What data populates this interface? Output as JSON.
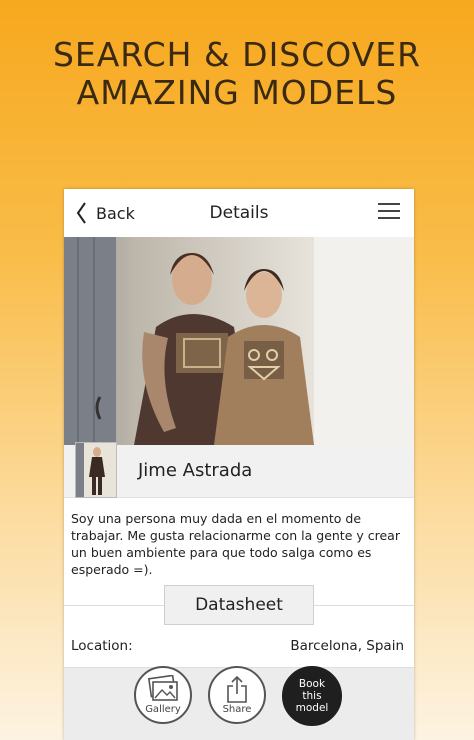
{
  "promo": {
    "headline_line1": "SEARCH & DISCOVER",
    "headline_line2": "AMAZING MODELS"
  },
  "navbar": {
    "back_label": "Back",
    "title": "Details",
    "menu_icon": "hamburger-menu-icon"
  },
  "model": {
    "name": "Jime Astrada",
    "bio": "Soy una persona muy dada en el momento de trabajar. Me gusta relacionarme con la gente y crear un buen ambiente para que todo salga como es esperado =)."
  },
  "datasheet": {
    "button_label": "Datasheet",
    "location_label": "Location:",
    "location_value": "Barcelona, Spain"
  },
  "actions": {
    "gallery_label": "Gallery",
    "share_label": "Share",
    "book_label": "Book\nthis\nmodel"
  },
  "colors": {
    "gradient_top": "#f7a81e",
    "gradient_bottom": "#fdf3e2",
    "headline_text": "#3a2a14",
    "book_button": "#1f1f1f"
  }
}
